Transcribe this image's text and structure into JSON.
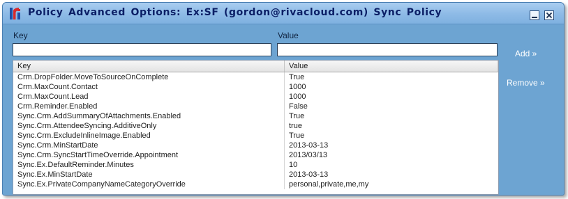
{
  "window": {
    "title": "Policy  Advanced  Options:  Ex:SF  (gordon@rivacloud.com)  Sync  Policy"
  },
  "form": {
    "key_label": "Key",
    "value_label": "Value",
    "key_value": "",
    "value_value": ""
  },
  "grid": {
    "columns": [
      "Key",
      "Value"
    ],
    "rows": [
      {
        "key": "Crm.DropFolder.MoveToSourceOnComplete",
        "value": "True"
      },
      {
        "key": "Crm.MaxCount.Contact",
        "value": "1000"
      },
      {
        "key": "Crm.MaxCount.Lead",
        "value": "1000"
      },
      {
        "key": "Crm.Reminder.Enabled",
        "value": "False"
      },
      {
        "key": "Sync.Crm.AddSummaryOfAttachments.Enabled",
        "value": "True"
      },
      {
        "key": "Sync.Crm.AttendeeSyncing.AdditiveOnly",
        "value": "true"
      },
      {
        "key": "Sync.Crm.ExcludeInlineImage.Enabled",
        "value": "True"
      },
      {
        "key": "Sync.Crm.MinStartDate",
        "value": "2013-03-13"
      },
      {
        "key": "Sync.Crm.SyncStartTimeOverride.Appointment",
        "value": "2013/03/13"
      },
      {
        "key": "Sync.Ex.DefaultReminder.Minutes",
        "value": "10"
      },
      {
        "key": "Sync.Ex.MinStartDate",
        "value": "2013-03-13"
      },
      {
        "key": "Sync.Ex.PrivateCompanyNameCategoryOverride",
        "value": "personal,private,me,my"
      }
    ]
  },
  "actions": {
    "add_label": "Add »",
    "remove_label": "Remove »"
  },
  "icons": {
    "app": "riva-logo-icon",
    "minimize": "minimize-icon",
    "close": "close-icon"
  },
  "colors": {
    "window_bg": "#6da4d2",
    "title_text": "#0b1f66",
    "logo_red": "#d6292c",
    "logo_blue": "#1f4fa8"
  }
}
